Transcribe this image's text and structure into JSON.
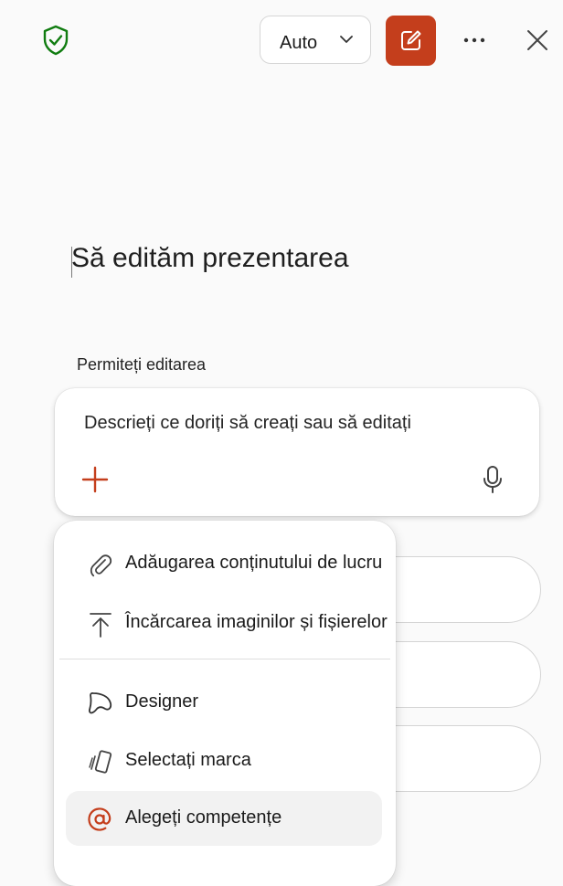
{
  "header": {
    "mode_label": "Auto"
  },
  "title": "Să edităm prezentarea",
  "permission_label": "Permiteți editarea",
  "prompt": {
    "placeholder": "Descrieți ce doriți să creați sau să editați"
  },
  "menu": {
    "items": [
      {
        "label": "Adăugarea conținutului de lucru",
        "icon": "paperclip-icon"
      },
      {
        "label": "Încărcarea imaginilor și fișierelor",
        "icon": "upload-icon"
      },
      {
        "label": "Designer",
        "icon": "designer-icon"
      },
      {
        "label": "Selectați marca",
        "icon": "brand-icon"
      },
      {
        "label": "Alegeți competențe",
        "icon": "at-sign-icon"
      }
    ]
  },
  "colors": {
    "accent": "#c43e1c",
    "shield": "#107c10",
    "background": "#fafafa"
  }
}
